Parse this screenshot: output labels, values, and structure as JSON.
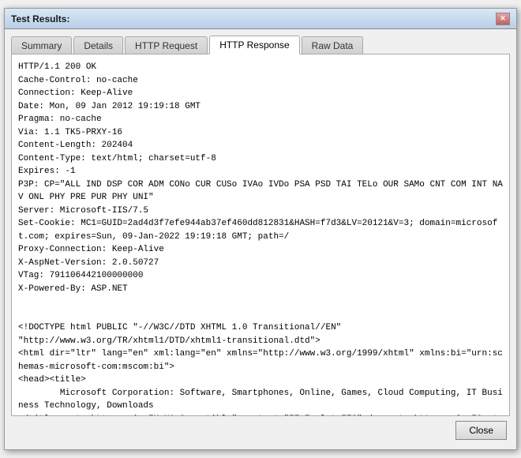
{
  "window": {
    "title": "Test Results:",
    "close_btn_label": "✕"
  },
  "tabs": [
    {
      "label": "Summary",
      "active": false
    },
    {
      "label": "Details",
      "active": false
    },
    {
      "label": "HTTP Request",
      "active": false
    },
    {
      "label": "HTTP Response",
      "active": true
    },
    {
      "label": "Raw Data",
      "active": false
    }
  ],
  "content": "HTTP/1.1 200 OK\nCache-Control: no-cache\nConnection: Keep-Alive\nDate: Mon, 09 Jan 2012 19:19:18 GMT\nPragma: no-cache\nVia: 1.1 TK5-PRXY-16\nContent-Length: 202404\nContent-Type: text/html; charset=utf-8\nExpires: -1\nP3P: CP=\"ALL IND DSP COR ADM CONo CUR CUSo IVAo IVDo PSA PSD TAI TELo OUR SAMo CNT COM INT NAV ONL PHY PRE PUR PHY UNI\"\nServer: Microsoft-IIS/7.5\nSet-Cookie: MC1=GUID=2ad4d3f7efe944ab37ef460dd812831&HASH=f7d3&LV=20121&V=3; domain=microsoft.com; expires=Sun, 09-Jan-2022 19:19:18 GMT; path=/\nProxy-Connection: Keep-Alive\nX-AspNet-Version: 2.0.50727\nVTag: 791106442100000000\nX-Powered-By: ASP.NET\n\n\n<!DOCTYPE html PUBLIC \"-//W3C//DTD XHTML 1.0 Transitional//EN\"\n\"http://www.w3.org/TR/xhtml1/DTD/xhtml1-transitional.dtd\">\n<html dir=\"ltr\" lang=\"en\" xml:lang=\"en\" xmlns=\"http://www.w3.org/1999/xhtml\" xmlns:bi=\"urn:schemas-microsoft-com:mscom:bi\">\n<head><title>\n        Microsoft Corporation: Software, Smartphones, Online, Games, Cloud Computing, IT Business Technology, Downloads\n</title><meta http-equiv=\"X-UA-Compatible\" content=\"IE=EmulateIE8\" /> <meta http-equiv=\"Content-Type\" content=\"text/html; charset=utf-8\" />\n<script type=\"text/javascript\">\nvar QosInitTime = (new Date()).getTime();\nvar QosLoadTime = '';\nvar QosPageUri = encodeURI(window.location);",
  "buttons": {
    "close_label": "Close"
  }
}
